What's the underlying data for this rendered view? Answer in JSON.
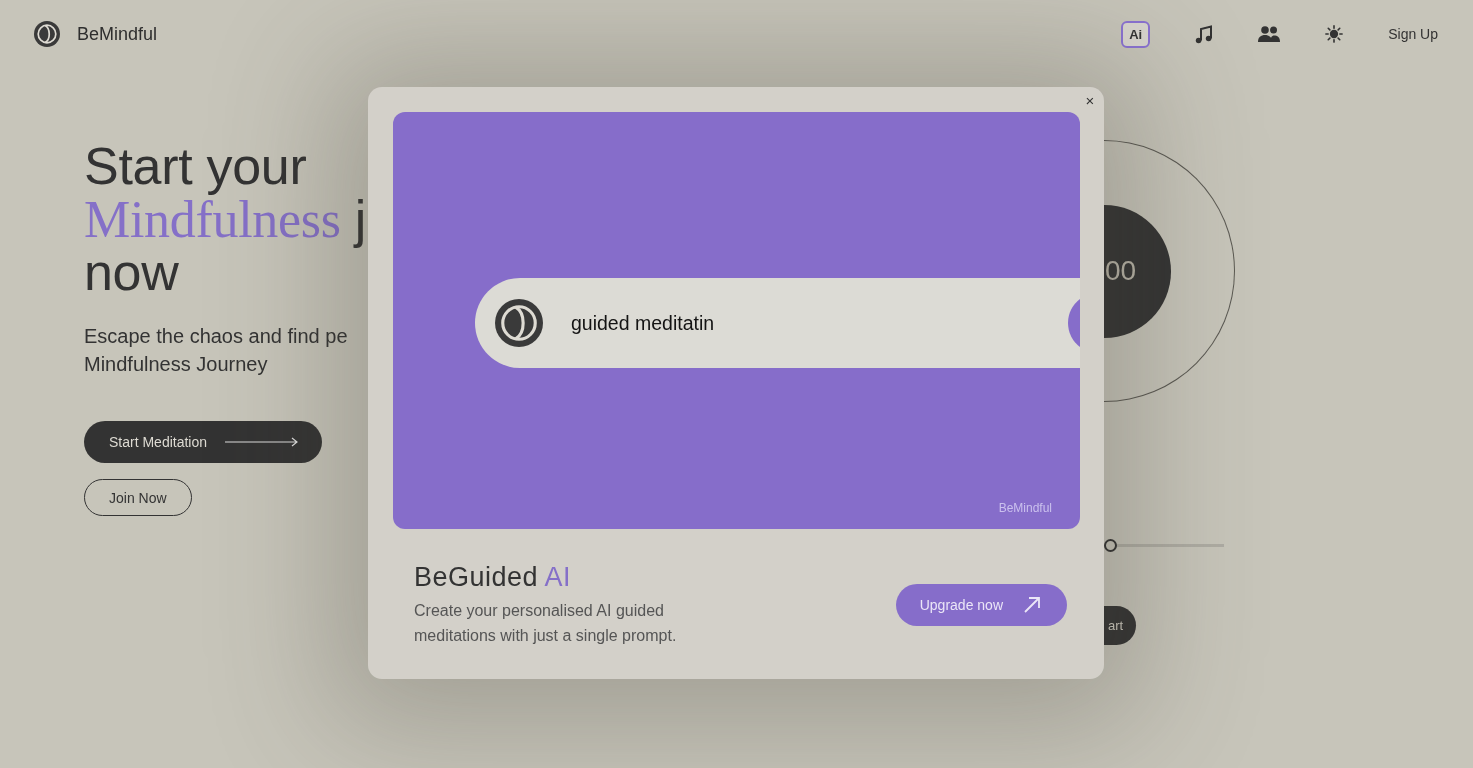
{
  "header": {
    "brand": "BeMindful",
    "nav_items": [
      {
        "kind": "ai",
        "label": "Ai"
      },
      {
        "kind": "music"
      },
      {
        "kind": "people"
      },
      {
        "kind": "theme"
      }
    ],
    "sign_up": "Sign Up"
  },
  "hero": {
    "heading_lines": [
      [
        {
          "text": "Start your",
          "kind": "plain"
        }
      ],
      [
        {
          "text": "Mindfulness",
          "kind": "accent"
        },
        {
          "text": "j",
          "kind": "plain"
        }
      ],
      [
        {
          "text": "now",
          "kind": "plain"
        }
      ]
    ],
    "subtitle_lines": [
      "Escape the chaos and find pe",
      "Mindfulness Journey"
    ],
    "buttons": [
      {
        "kind": "primary",
        "label": "Start Meditation"
      },
      {
        "kind": "outline",
        "label": "Join Now"
      }
    ]
  },
  "timer": {
    "reading": "00",
    "slider": {
      "level": 0
    },
    "button": "art"
  },
  "modal": {
    "close": "×",
    "demo": {
      "prompt": "guided meditatin",
      "brand_mark": "BeMindful"
    },
    "title": "BeGuided",
    "title_accent": "AI",
    "description": "Create your personalised AI guided meditations with just a single prompt.",
    "button": "Upgrade now"
  }
}
